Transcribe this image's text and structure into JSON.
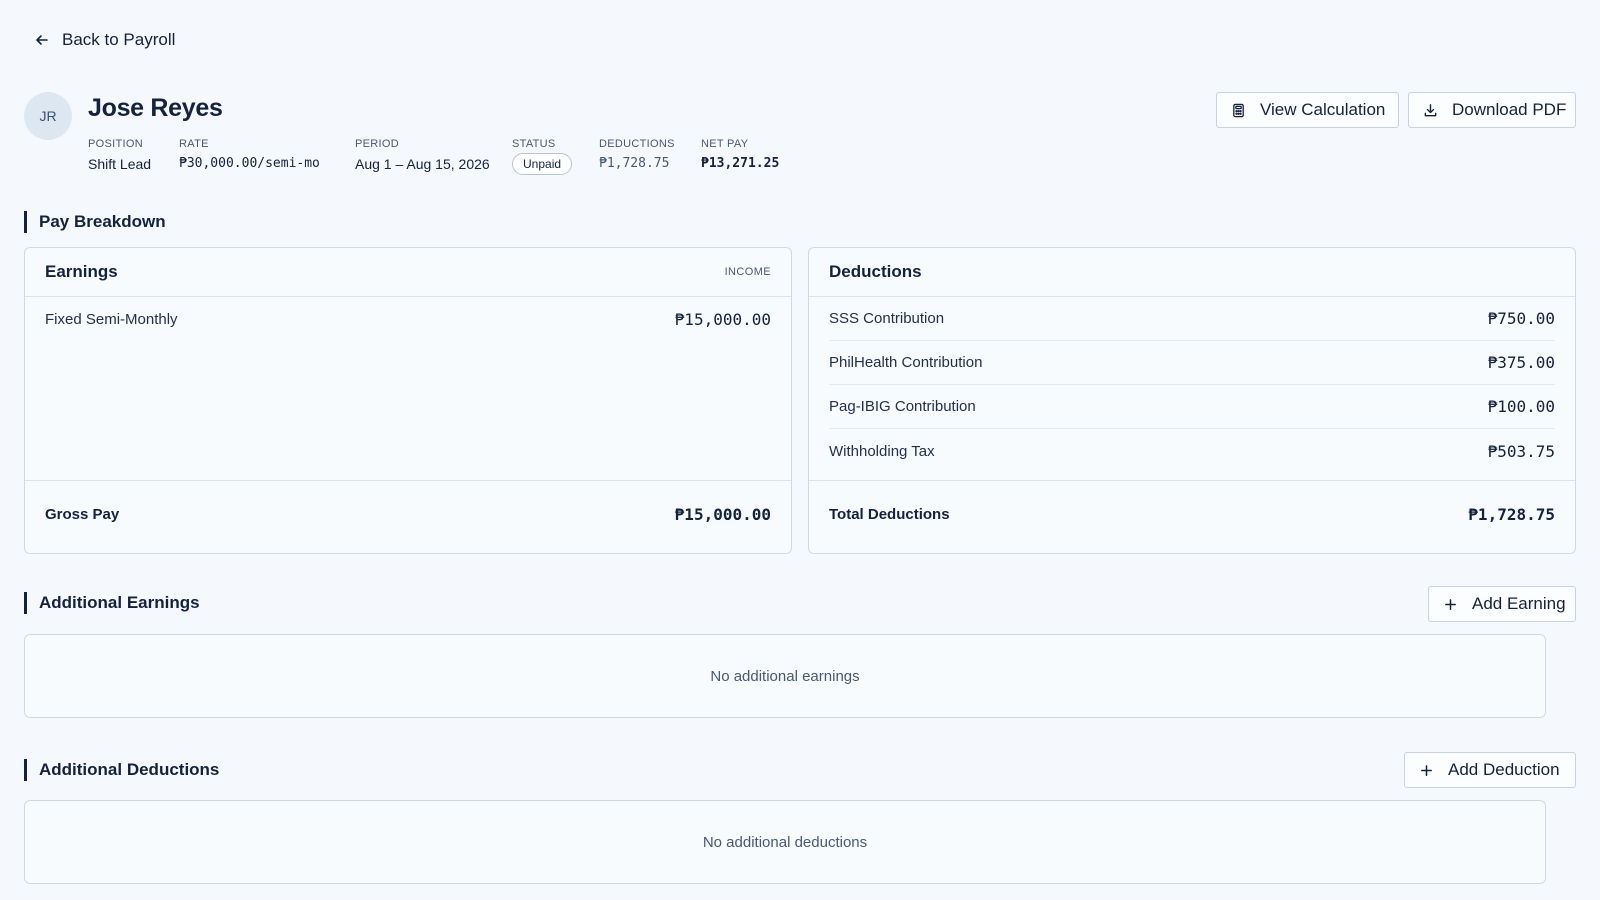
{
  "nav": {
    "back_label": "Back to Payroll"
  },
  "employee": {
    "initials": "JR",
    "name": "Jose Reyes",
    "meta": {
      "position_label": "POSITION",
      "position": "Shift Lead",
      "rate_label": "RATE",
      "rate": "₱30,000.00/semi-mo",
      "period_label": "PERIOD",
      "period": "Aug 1 – Aug 15, 2026",
      "status_label": "STATUS",
      "status": "Unpaid",
      "deductions_label": "DEDUCTIONS",
      "deductions": "₱1,728.75",
      "net_pay_label": "NET PAY",
      "net_pay": "₱13,271.25"
    }
  },
  "actions": {
    "view_calculation": "View Calculation",
    "download_pdf": "Download PDF"
  },
  "pay_breakdown": {
    "title": "Pay Breakdown",
    "earnings": {
      "title": "Earnings",
      "tag": "INCOME",
      "items": [
        {
          "label": "Fixed Semi-Monthly",
          "amount": "₱15,000.00"
        }
      ],
      "total_label": "Gross Pay",
      "total": "₱15,000.00"
    },
    "deductions": {
      "title": "Deductions",
      "items": [
        {
          "label": "SSS Contribution",
          "amount": "₱750.00"
        },
        {
          "label": "PhilHealth Contribution",
          "amount": "₱375.00"
        },
        {
          "label": "Pag-IBIG Contribution",
          "amount": "₱100.00"
        },
        {
          "label": "Withholding Tax",
          "amount": "₱503.75"
        }
      ],
      "total_label": "Total Deductions",
      "total": "₱1,728.75"
    }
  },
  "additional_earnings": {
    "title": "Additional Earnings",
    "add_label": "Add Earning",
    "empty_text": "No additional earnings"
  },
  "additional_deductions": {
    "title": "Additional Deductions",
    "add_label": "Add Deduction",
    "empty_text": "No additional deductions"
  }
}
